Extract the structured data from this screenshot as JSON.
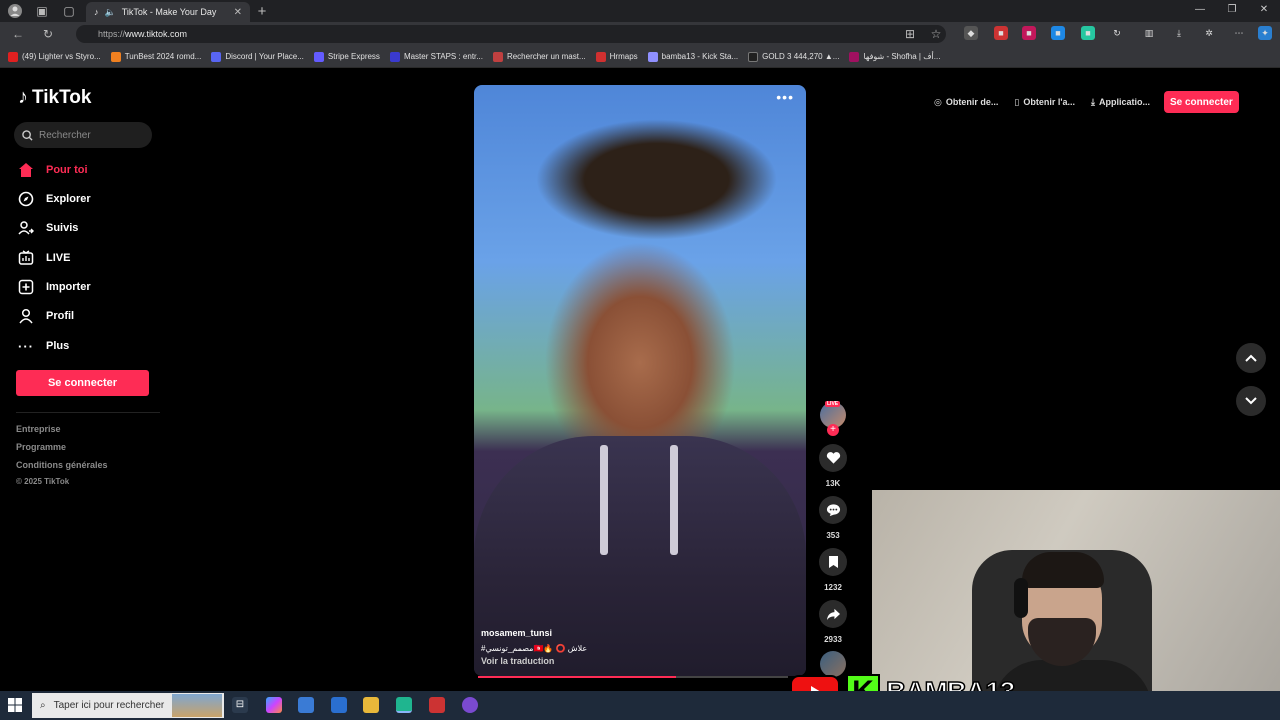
{
  "browser": {
    "tab_title": "TikTok - Make Your Day",
    "url_scheme": "https://",
    "url_host": "www.tiktok.com",
    "bookmarks": [
      {
        "label": "(49) Lighter vs Styro...",
        "color": "#e02020"
      },
      {
        "label": "TunBest 2024 romd...",
        "color": "#f08020"
      },
      {
        "label": "Discord | Your Place...",
        "color": "#5865f2"
      },
      {
        "label": "Stripe Express",
        "color": "#635bff"
      },
      {
        "label": "Master STAPS : entr...",
        "color": "#3a3ad0"
      },
      {
        "label": "Rechercher un mast...",
        "color": "#c04040"
      },
      {
        "label": "Hrmaps",
        "color": "#d03030"
      },
      {
        "label": "bamba13 - Kick Sta...",
        "color": "#9090ff"
      },
      {
        "label": "GOLD 3 444,270 ▲...",
        "color": "#202020"
      },
      {
        "label": "شوفها - Shofha | أف...",
        "color": "#a01060"
      }
    ]
  },
  "tiktok": {
    "logo": "TikTok",
    "search_placeholder": "Rechercher",
    "nav": [
      {
        "label": "Pour toi",
        "icon": "home-icon",
        "active": true
      },
      {
        "label": "Explorer",
        "icon": "compass-icon",
        "active": false
      },
      {
        "label": "Suivis",
        "icon": "following-icon",
        "active": false
      },
      {
        "label": "LIVE",
        "icon": "live-icon",
        "active": false
      },
      {
        "label": "Importer",
        "icon": "upload-icon",
        "active": false
      },
      {
        "label": "Profil",
        "icon": "profile-icon",
        "active": false
      },
      {
        "label": "Plus",
        "icon": "more-icon",
        "active": false
      }
    ],
    "login_button": "Se connecter",
    "footer": {
      "entreprise": "Entreprise",
      "programme": "Programme",
      "conditions": "Conditions générales",
      "copyright": "© 2025 TikTok"
    },
    "top_actions": {
      "coins": "Obtenir de...",
      "app": "Obtenir l'a...",
      "desktop": "Applicatio...",
      "login": "Se connecter"
    },
    "video": {
      "author": "mosamem_tunsi",
      "description": "#مصمم_تونسي🇹🇳🔥 ⭕ علاش",
      "translate": "Voir la traduction",
      "progress": 0.64,
      "live_badge": "LIVE",
      "likes": "13K",
      "comments": "353",
      "saves": "1232",
      "shares": "2933"
    }
  },
  "overlay": {
    "streamer_name": "BAMBA13",
    "kick_letter": "K"
  },
  "taskbar": {
    "search_placeholder": "Taper ici pour rechercher"
  }
}
